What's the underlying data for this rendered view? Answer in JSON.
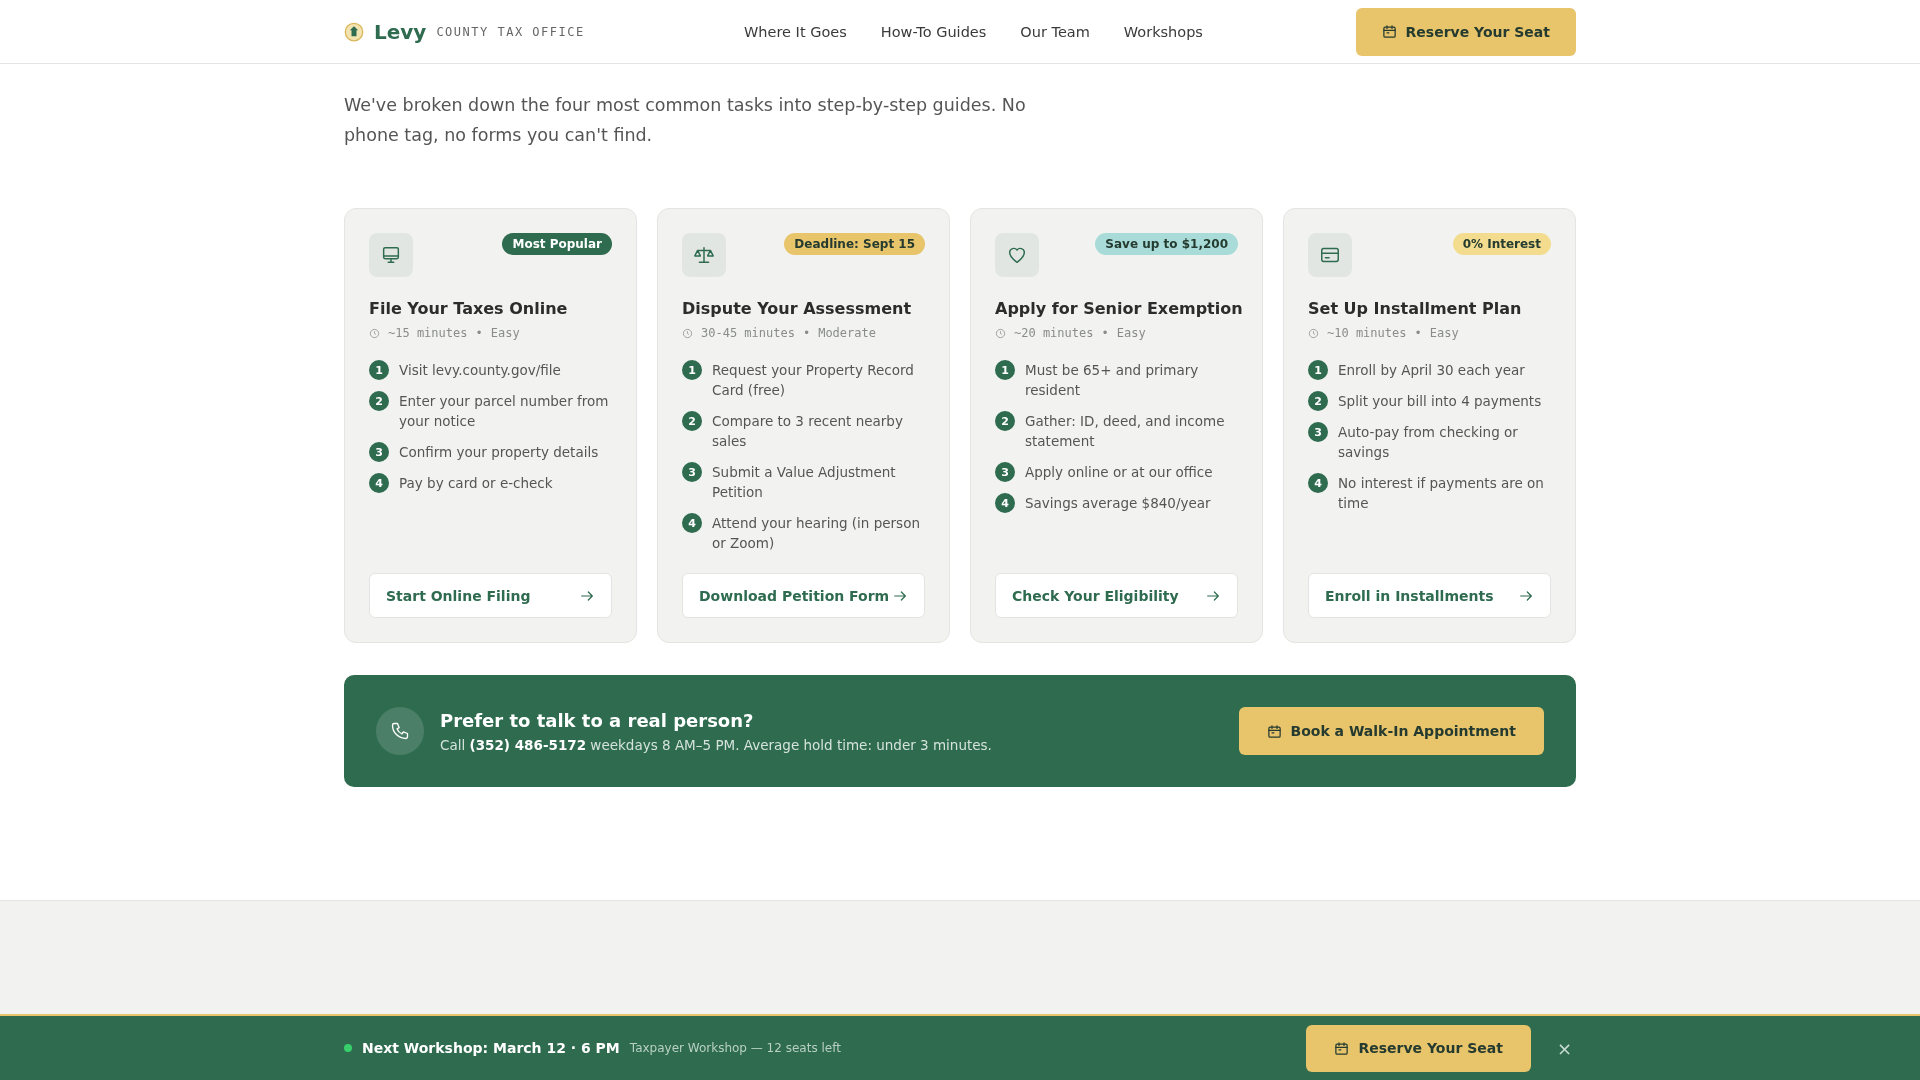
{
  "header": {
    "brand": "Levy",
    "tagline": "COUNTY TAX OFFICE",
    "nav": [
      {
        "label": "Where It Goes"
      },
      {
        "label": "How-To Guides"
      },
      {
        "label": "Our Team"
      },
      {
        "label": "Workshops"
      }
    ],
    "cta": "Reserve Your Seat"
  },
  "intro": {
    "subtitle": "We've broken down the four most common tasks into step-by-step guides. No phone tag, no forms you can't find."
  },
  "cards": [
    {
      "kind": "monitor",
      "badge": "Most Popular",
      "color": "#2e6b4f",
      "title": "File Your Taxes Online",
      "time": "~15 minutes",
      "separator": "•",
      "difficulty": "Easy",
      "steps": [
        {
          "number": "1",
          "text": "Visit levy.county.gov/file"
        },
        {
          "number": "2",
          "text": "Enter your parcel number from your notice"
        },
        {
          "number": "3",
          "text": "Confirm your property details"
        },
        {
          "number": "4",
          "text": "Pay by card or e-check"
        }
      ],
      "action": "Start Online Filing"
    },
    {
      "kind": "scale",
      "badge": "Deadline: Sept 15",
      "color": "#e8c46a",
      "title": "Dispute Your Assessment",
      "time": "30-45 minutes",
      "separator": "•",
      "difficulty": "Moderate",
      "steps": [
        {
          "number": "1",
          "text": "Request your Property Record Card (free)"
        },
        {
          "number": "2",
          "text": "Compare to 3 recent nearby sales"
        },
        {
          "number": "3",
          "text": "Submit a Value Adjustment Petition"
        },
        {
          "number": "4",
          "text": "Attend your hearing (in person or Zoom)"
        }
      ],
      "action": "Download Petition Form"
    },
    {
      "kind": "heart",
      "badge": "Save up to $1,200",
      "color": "#a9dcd8",
      "title": "Apply for Senior Exemption",
      "time": "~20 minutes",
      "separator": "•",
      "difficulty": "Easy",
      "steps": [
        {
          "number": "1",
          "text": "Must be 65+ and primary resident"
        },
        {
          "number": "2",
          "text": "Gather: ID, deed, and income statement"
        },
        {
          "number": "3",
          "text": "Apply online or at our office"
        },
        {
          "number": "4",
          "text": "Savings average $840/year"
        }
      ],
      "action": "Check Your Eligibility"
    },
    {
      "kind": "card",
      "badge": "0% Interest",
      "color": "#f3dc8e",
      "title": "Set Up Installment Plan",
      "time": "~10 minutes",
      "separator": "•",
      "difficulty": "Easy",
      "steps": [
        {
          "number": "1",
          "text": "Enroll by April 30 each year"
        },
        {
          "number": "2",
          "text": "Split your bill into 4 payments"
        },
        {
          "number": "3",
          "text": "Auto-pay from checking or savings"
        },
        {
          "number": "4",
          "text": "No interest if payments are on time"
        }
      ],
      "action": "Enroll in Installments"
    }
  ],
  "contact": {
    "title": "Prefer to talk to a real person?",
    "text": "Call **(352) 486-5172** weekdays 8 AM–5 PM. Average hold time: under 3 minutes.",
    "action": "Book a Walk-In Appointment"
  },
  "workshop_bar": {
    "title": "Next Workshop: March 12 · 6 PM",
    "detail": "Taxpayer Workshop — 12 seats left",
    "action": "Reserve Your Seat",
    "close": "×"
  }
}
